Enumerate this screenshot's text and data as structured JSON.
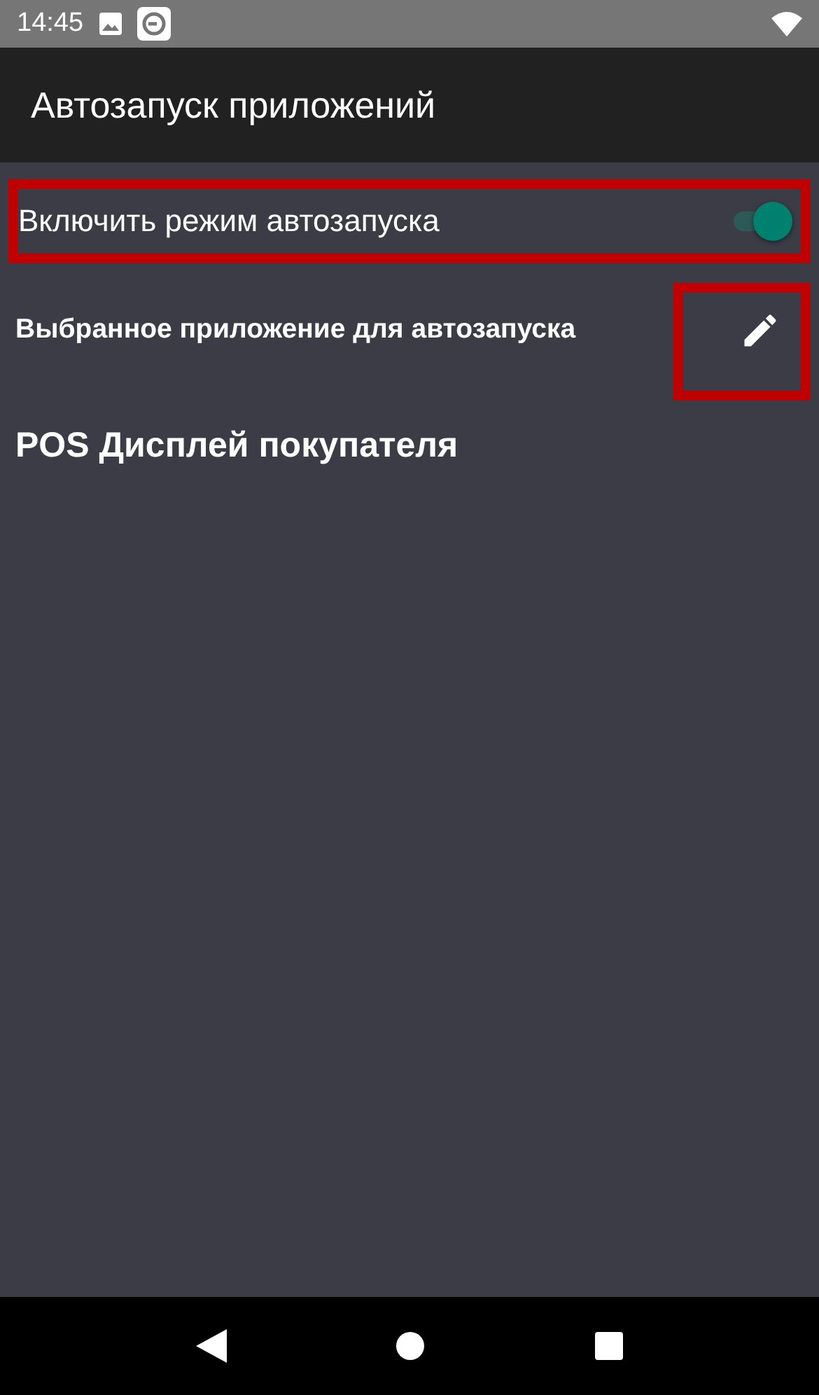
{
  "status_bar": {
    "time": "14:45"
  },
  "app_bar": {
    "title": "Автозапуск приложений"
  },
  "autostart_toggle": {
    "label": "Включить режим автозапуска",
    "on": true,
    "highlighted": true
  },
  "selected_app": {
    "label": "Выбранное приложение для автозапуска",
    "edit_highlighted": true,
    "value": "POS Дисплей покупателя"
  }
}
